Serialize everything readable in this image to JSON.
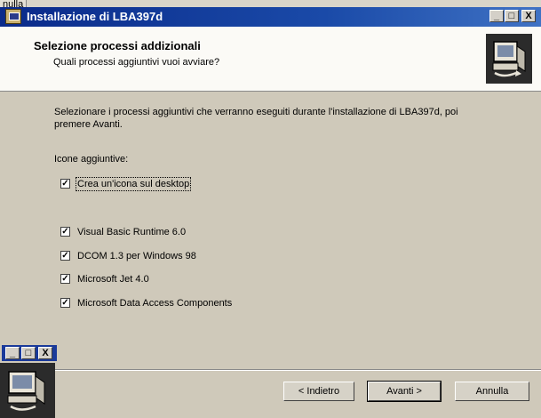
{
  "background_window": {
    "label": "nulla"
  },
  "window": {
    "title": "Installazione di LBA397d",
    "controls": {
      "minimize": "_",
      "maximize": "□",
      "close": "X"
    }
  },
  "header": {
    "title": "Selezione processi addizionali",
    "subtitle": "Quali processi aggiuntivi vuoi avviare?",
    "icon": "computer-setup-icon"
  },
  "body": {
    "intro": "Selezionare i processi aggiuntivi che verranno eseguiti durante l'installazione di LBA397d, poi premere Avanti.",
    "group_label": "Icone aggiuntive:",
    "tasks": [
      {
        "label": "Crea un'icona sul desktop",
        "checked": true
      },
      {
        "label": "Visual Basic Runtime 6.0",
        "checked": true
      },
      {
        "label": "DCOM 1.3 per Windows 98",
        "checked": true
      },
      {
        "label": "Microsoft Jet 4.0",
        "checked": true
      },
      {
        "label": "Microsoft Data Access Components",
        "checked": true
      }
    ],
    "check_glyph": "✓"
  },
  "footer": {
    "back_label": "< Indietro",
    "next_label": "Avanti >",
    "cancel_label": "Annulla"
  },
  "colors": {
    "titlebar": "#0a2a8a",
    "dialog_bg": "#cfc9ba",
    "header_bg": "#fbfaf6"
  }
}
